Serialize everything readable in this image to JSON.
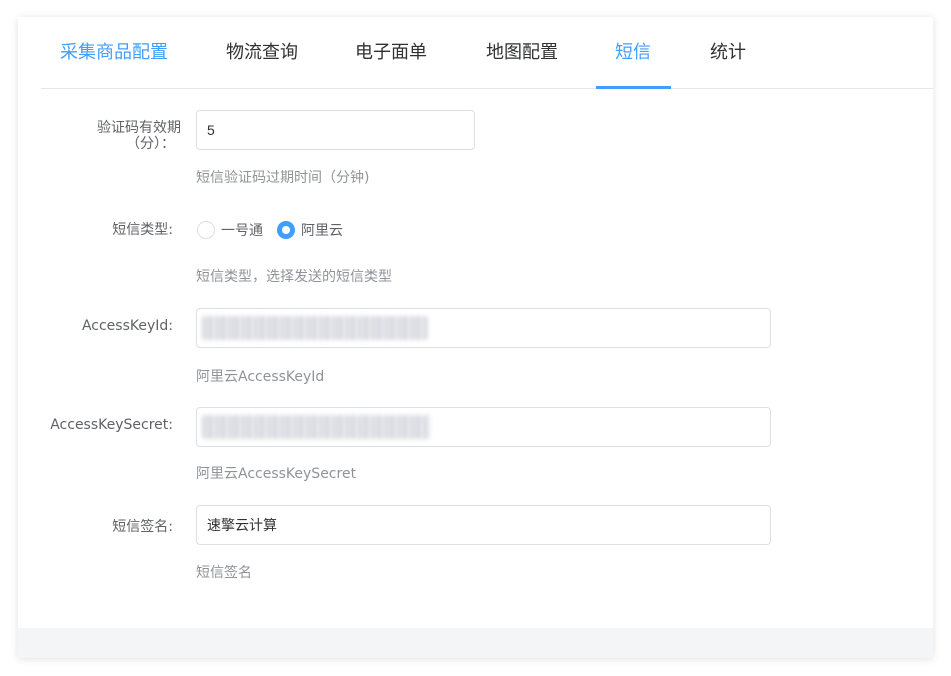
{
  "tabs": [
    {
      "label": "采集商品配置"
    },
    {
      "label": "物流查询"
    },
    {
      "label": "电子面单"
    },
    {
      "label": "地图配置"
    },
    {
      "label": "短信"
    },
    {
      "label": "统计"
    }
  ],
  "active_tab": "短信",
  "form": {
    "code_expiry": {
      "label_line1": "验证码有效期",
      "label_line2": "（分）：",
      "value": "5",
      "hint": "短信验证码过期时间（分钟)"
    },
    "sms_type": {
      "label": "短信类型:",
      "options": [
        {
          "label": "一号通",
          "checked": false
        },
        {
          "label": "阿里云",
          "checked": true
        }
      ],
      "hint": "短信类型，选择发送的短信类型"
    },
    "access_key_id": {
      "label": "AccessKeyId:",
      "hint": "阿里云AccessKeyId"
    },
    "access_key_secret": {
      "label": "AccessKeySecret:",
      "hint": "阿里云AccessKeySecret"
    },
    "sms_signature": {
      "label": "短信签名:",
      "value": "速擎云计算",
      "hint": "短信签名"
    }
  },
  "colors": {
    "accent": "#409eff",
    "text": "#303133",
    "label": "#606266",
    "hint": "#909399",
    "border": "#dcdfe6"
  }
}
